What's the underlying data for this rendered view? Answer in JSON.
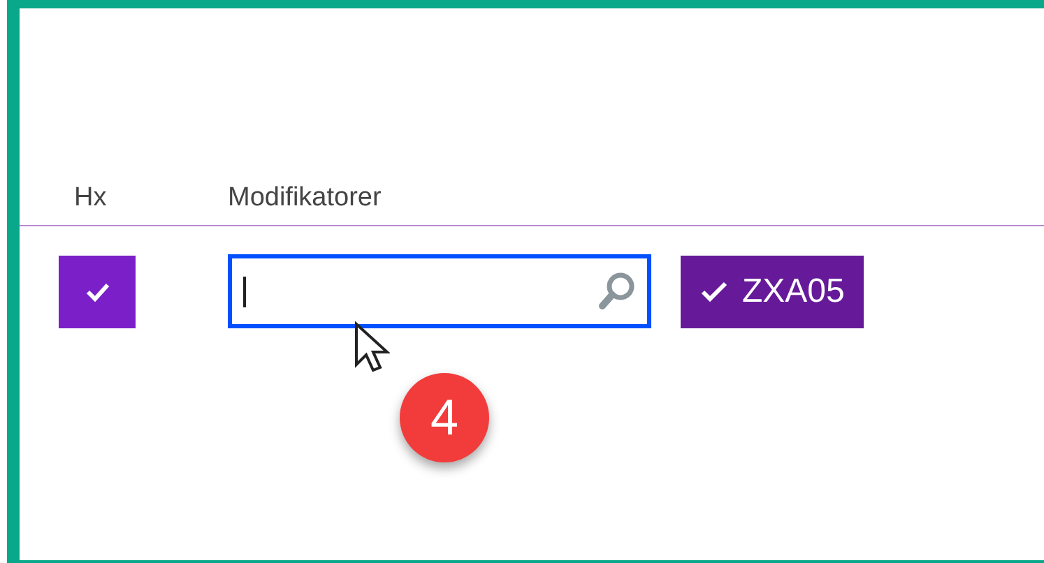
{
  "table": {
    "columns": [
      "Hx",
      "Modifikatorer"
    ],
    "rows": [
      {
        "hx_checked": true,
        "search": {
          "focused": true
        },
        "tags": [
          {
            "label": "ZXA05",
            "selected": true
          }
        ]
      }
    ]
  },
  "step_badge": "4"
}
